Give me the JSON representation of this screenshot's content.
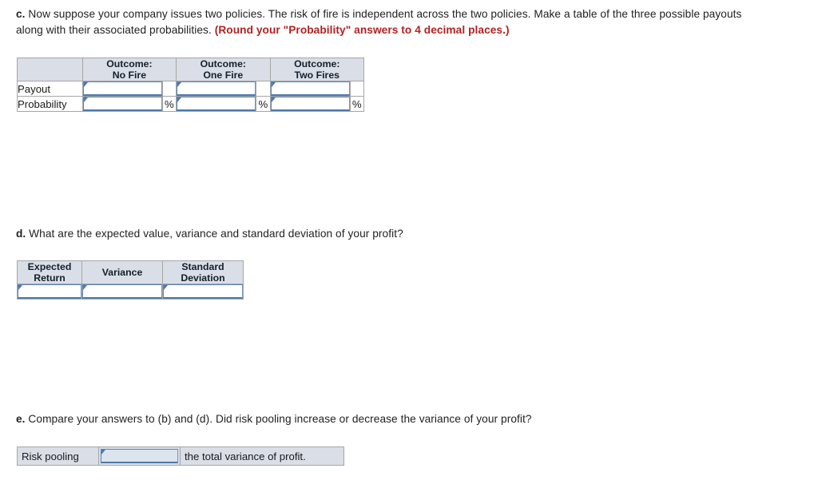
{
  "questions": {
    "c": {
      "label": "c.",
      "text": " Now suppose your company issues two policies. The risk of fire is independent across the two policies. Make a table of the three possible payouts along with their associated probabilities. ",
      "note": "(Round your \"Probability\" answers to 4 decimal places.)"
    },
    "d": {
      "label": "d.",
      "text": " What are the expected value, variance and standard deviation of your profit?"
    },
    "e": {
      "label": "e.",
      "text": " Compare your answers to (b) and (d). Did risk pooling increase or decrease the variance of your profit?"
    }
  },
  "payout_table": {
    "corner_header": "",
    "headers": [
      {
        "line1": "Outcome:",
        "line2": "No Fire"
      },
      {
        "line1": "Outcome:",
        "line2": "One Fire"
      },
      {
        "line1": "Outcome:",
        "line2": "Two Fires"
      }
    ],
    "rows": [
      {
        "label": "Payout",
        "cells": [
          {
            "value": "",
            "unit": ""
          },
          {
            "value": "",
            "unit": ""
          },
          {
            "value": "",
            "unit": ""
          }
        ]
      },
      {
        "label": "Probability",
        "cells": [
          {
            "value": "",
            "unit": "%"
          },
          {
            "value": "",
            "unit": "%"
          },
          {
            "value": "",
            "unit": "%"
          }
        ]
      }
    ]
  },
  "stats_table": {
    "headers": [
      {
        "line1": "Expected",
        "line2": "Return"
      },
      {
        "line1": "Variance",
        "line2": ""
      },
      {
        "line1": "Standard",
        "line2": "Deviation"
      }
    ],
    "values": [
      "",
      "",
      ""
    ]
  },
  "risk_pooling": {
    "prefix_label": "Risk pooling",
    "selected_option": "",
    "suffix_label": "the total variance of profit."
  },
  "colors": {
    "header_fill": "#d9dee7",
    "input_border": "#5b85b7",
    "marker": "#4a7ab5",
    "note_red": "#b22222",
    "grid_line": "#a6a6a6"
  }
}
